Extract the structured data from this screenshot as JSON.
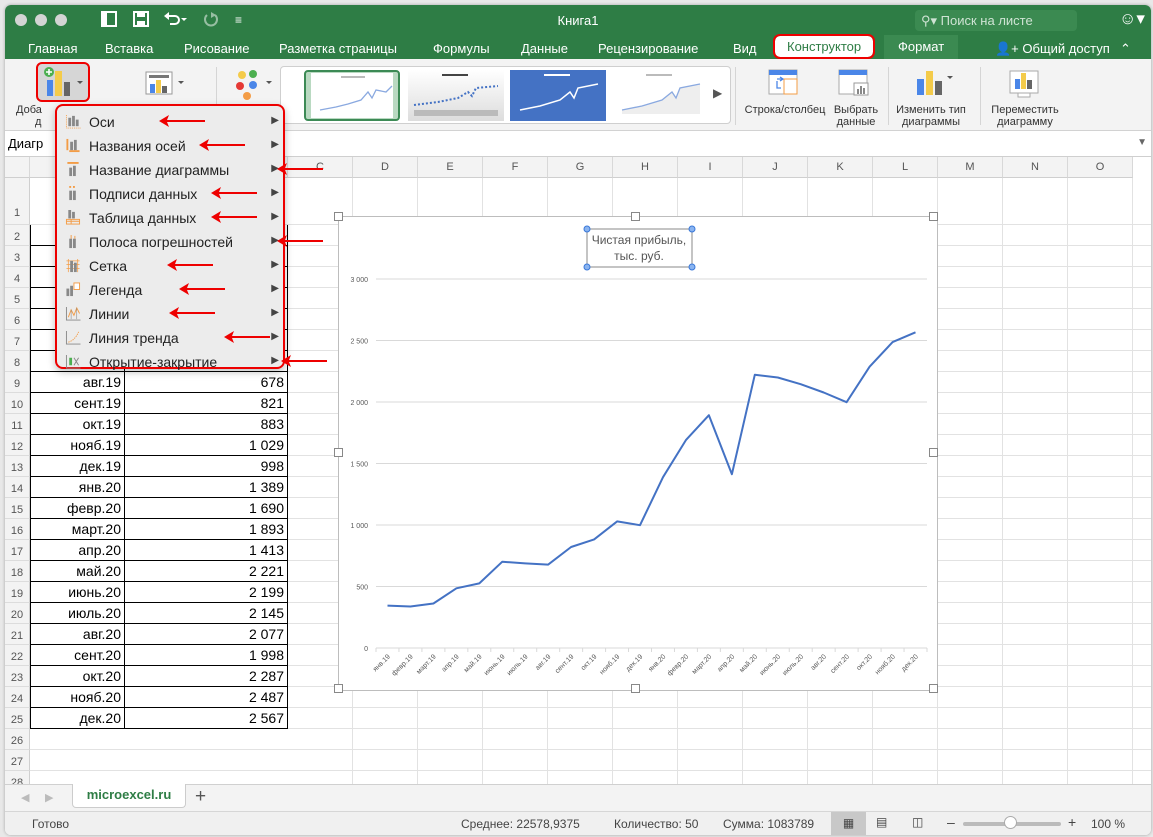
{
  "window": {
    "title": "Книга1",
    "search_placeholder": "Поиск на листе"
  },
  "quick_access": {
    "icons": [
      "sidebar-icon",
      "save-icon",
      "undo-icon",
      "redo-icon",
      "customize-icon"
    ]
  },
  "tabs": [
    {
      "label": "Главная"
    },
    {
      "label": "Вставка"
    },
    {
      "label": "Рисование"
    },
    {
      "label": "Разметка страницы"
    },
    {
      "label": "Формулы"
    },
    {
      "label": "Данные"
    },
    {
      "label": "Рецензирование"
    },
    {
      "label": "Вид"
    },
    {
      "label": "Конструктор",
      "active": true
    },
    {
      "label": "Формат"
    }
  ],
  "share_label": "Общий доступ",
  "ribbon": {
    "add_element_label_1": "Доба",
    "add_element_label_2": "д",
    "switch_row_col": "Строка/столбец",
    "select_data_1": "Выбрать",
    "select_data_2": "данные",
    "change_type_1": "Изменить тип",
    "change_type_2": "диаграммы",
    "move_chart_1": "Переместить",
    "move_chart_2": "диаграмму",
    "gallery_thumb_title": "Чистая прибыль, тыс. руб."
  },
  "name_box": "Диагр",
  "menu": {
    "items": [
      {
        "label": "Оси",
        "icon": "axes-icon"
      },
      {
        "label": "Названия осей",
        "icon": "axis-titles-icon"
      },
      {
        "label": "Название диаграммы",
        "icon": "chart-title-icon"
      },
      {
        "label": "Подписи данных",
        "icon": "data-labels-icon"
      },
      {
        "label": "Таблица данных",
        "icon": "data-table-icon"
      },
      {
        "label": "Полоса погрешностей",
        "icon": "error-bars-icon"
      },
      {
        "label": "Сетка",
        "icon": "gridlines-icon"
      },
      {
        "label": "Легенда",
        "icon": "legend-icon"
      },
      {
        "label": "Линии",
        "icon": "lines-icon"
      },
      {
        "label": "Линия тренда",
        "icon": "trendline-icon"
      },
      {
        "label": "Открытие-закрытие",
        "icon": "up-down-bars-icon"
      }
    ]
  },
  "columns": [
    "C",
    "D",
    "E",
    "F",
    "G",
    "H",
    "I",
    "J",
    "K",
    "L",
    "M",
    "N",
    "O"
  ],
  "rows": [
    {
      "n": "1"
    },
    {
      "n": "2"
    },
    {
      "n": "3"
    },
    {
      "n": "4"
    },
    {
      "n": "5"
    },
    {
      "n": "6"
    },
    {
      "n": "7"
    },
    {
      "n": "8"
    },
    {
      "n": "9",
      "a": "авг.19",
      "b": "678"
    },
    {
      "n": "10",
      "a": "сент.19",
      "b": "821"
    },
    {
      "n": "11",
      "a": "окт.19",
      "b": "883"
    },
    {
      "n": "12",
      "a": "нояб.19",
      "b": "1 029"
    },
    {
      "n": "13",
      "a": "дек.19",
      "b": "998"
    },
    {
      "n": "14",
      "a": "янв.20",
      "b": "1 389"
    },
    {
      "n": "15",
      "a": "февр.20",
      "b": "1 690"
    },
    {
      "n": "16",
      "a": "март.20",
      "b": "1 893"
    },
    {
      "n": "17",
      "a": "апр.20",
      "b": "1 413"
    },
    {
      "n": "18",
      "a": "май.20",
      "b": "2 221"
    },
    {
      "n": "19",
      "a": "июнь.20",
      "b": "2 199"
    },
    {
      "n": "20",
      "a": "июль.20",
      "b": "2 145"
    },
    {
      "n": "21",
      "a": "авг.20",
      "b": "2 077"
    },
    {
      "n": "22",
      "a": "сент.20",
      "b": "1 998"
    },
    {
      "n": "23",
      "a": "окт.20",
      "b": "2 287"
    },
    {
      "n": "24",
      "a": "нояб.20",
      "b": "2 487"
    },
    {
      "n": "25",
      "a": "дек.20",
      "b": "2 567"
    },
    {
      "n": "26"
    },
    {
      "n": "27"
    },
    {
      "n": "28"
    }
  ],
  "chart_data": {
    "type": "line",
    "title": "Чистая прибыль, тыс. руб.",
    "title_line1": "Чистая прибыль,",
    "title_line2": "тыс. руб.",
    "xlabel": "",
    "ylabel": "",
    "ylim": [
      0,
      3000
    ],
    "yticks": [
      0,
      500,
      1000,
      1500,
      2000,
      2500,
      3000
    ],
    "ytick_labels": [
      "0",
      "500",
      "1 000",
      "1 500",
      "2 000",
      "2 500",
      "3 000"
    ],
    "grid": true,
    "legend": "none",
    "categories": [
      "янв.19",
      "февр.19",
      "март.19",
      "апр.19",
      "май.19",
      "июнь.19",
      "июль.19",
      "авг.19",
      "сент.19",
      "окт.19",
      "нояб.19",
      "дек.19",
      "янв.20",
      "февр.20",
      "март.20",
      "апр.20",
      "май.20",
      "июнь.20",
      "июль.20",
      "авг.20",
      "сент.20",
      "окт.20",
      "нояб.20",
      "дек.20"
    ],
    "series": [
      {
        "name": "Чистая прибыль, тыс. руб.",
        "color": "#4472c4",
        "values": [
          345,
          337,
          362,
          485,
          525,
          702,
          688,
          678,
          821,
          883,
          1029,
          998,
          1389,
          1690,
          1893,
          1413,
          2221,
          2199,
          2145,
          2077,
          1998,
          2287,
          2487,
          2567
        ]
      }
    ]
  },
  "sheet_tab": "microexcel.ru",
  "status": {
    "ready": "Готово",
    "average": "Среднее: 22578,9375",
    "count": "Количество: 50",
    "sum": "Сумма: 1083789",
    "zoom": "100 %",
    "zoom_level_percent": 100
  },
  "colors": {
    "brand_green": "#2e7d45",
    "highlight_red": "#e00000",
    "series_blue": "#4472c4"
  }
}
